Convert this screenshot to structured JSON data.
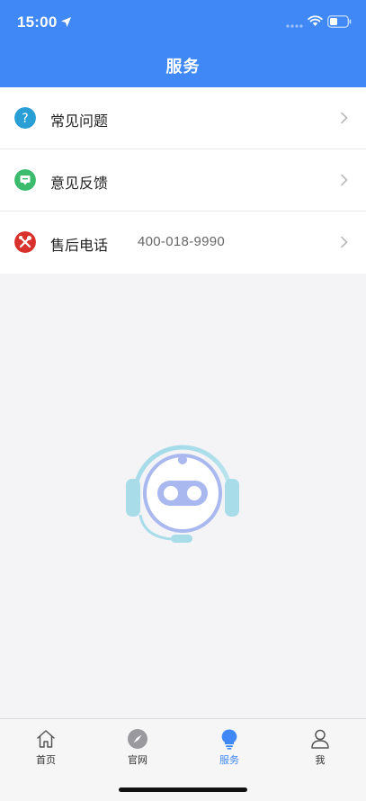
{
  "status_bar": {
    "time": "15:00"
  },
  "header": {
    "title": "服务"
  },
  "menu": {
    "items": [
      {
        "label": "常见问题",
        "icon": "question-icon",
        "color": "#2a9fd6"
      },
      {
        "label": "意见反馈",
        "icon": "feedback-icon",
        "color": "#3dbb6c"
      },
      {
        "label": "售后电话",
        "value": "400-018-9990",
        "icon": "tools-icon",
        "color": "#d9312b"
      }
    ]
  },
  "tabbar": {
    "tabs": [
      {
        "label": "首页",
        "icon": "home-icon"
      },
      {
        "label": "官网",
        "icon": "compass-icon"
      },
      {
        "label": "服务",
        "icon": "bulb-icon",
        "active": true
      },
      {
        "label": "我",
        "icon": "person-icon"
      }
    ]
  },
  "colors": {
    "accent": "#3f88f6",
    "background": "#f4f4f6"
  }
}
